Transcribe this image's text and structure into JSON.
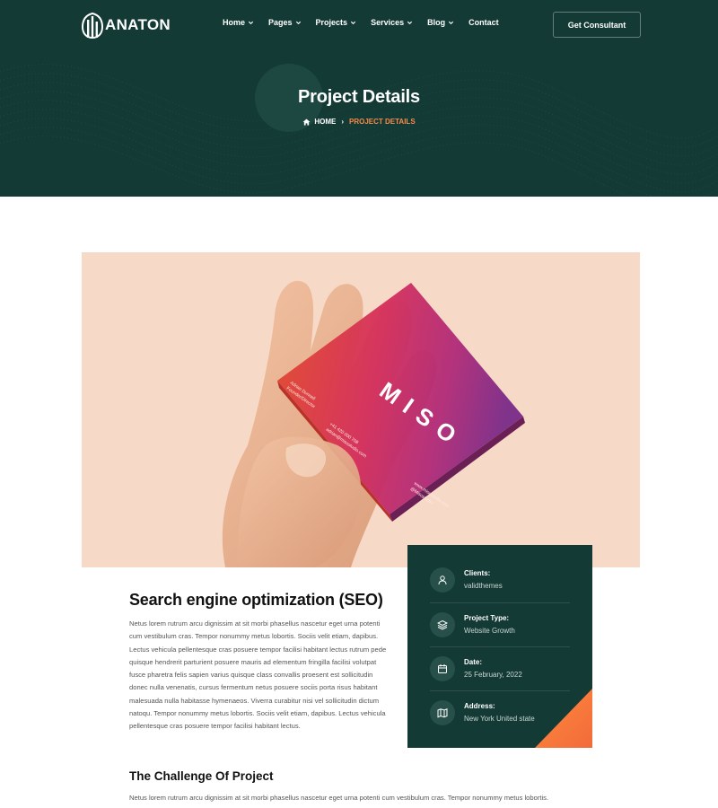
{
  "brand": {
    "name": "ANATON"
  },
  "nav": {
    "items": [
      {
        "label": "Home",
        "dropdown": true
      },
      {
        "label": "Pages",
        "dropdown": true
      },
      {
        "label": "Projects",
        "dropdown": true
      },
      {
        "label": "Services",
        "dropdown": true
      },
      {
        "label": "Blog",
        "dropdown": true
      },
      {
        "label": "Contact",
        "dropdown": false
      }
    ],
    "cta_label": "Get Consultant"
  },
  "hero": {
    "title": "Project Details",
    "breadcrumb": {
      "home": "HOME",
      "separator": "›",
      "current": "PROJECT DETAILS"
    }
  },
  "project_image": {
    "card_brand": "MISO",
    "card_name": "Adrian Dunnell",
    "card_role": "Founder/Director",
    "card_phone": "+41 420 000 708",
    "card_email": "adrian@misostudio.com",
    "card_web": "www.misostudio.com",
    "card_handle": "@Misostudio"
  },
  "info_card": {
    "items": [
      {
        "label": "Clients:",
        "value": "validthemes",
        "icon": "user-icon"
      },
      {
        "label": "Project Type:",
        "value": "Website Growth",
        "icon": "layers-icon"
      },
      {
        "label": "Date:",
        "value": "25 February, 2022",
        "icon": "calendar-icon"
      },
      {
        "label": "Address:",
        "value": "New York United state",
        "icon": "map-icon"
      }
    ]
  },
  "content": {
    "section_title": "Search engine optimization (SEO)",
    "section_body": "Netus lorem rutrum arcu dignissim at sit morbi phasellus nascetur eget urna potenti cum vestibulum cras. Tempor nonummy metus lobortis. Sociis velit etiam, dapibus. Lectus vehicula pellentesque cras posuere tempor facilisi habitant lectus rutrum pede quisque hendrerit parturient posuere mauris ad elementum fringilla facilisi volutpat fusce pharetra felis sapien varius quisque class convallis proesent est sollicitudin donec nulla venenatis, cursus fermentum netus posuere sociis porta risus habitant malesuada nulla habitasse hymenaeos. Viverra curabitur nisi vel sollicitudin dictum natoqu. Tempor nonummy metus lobortis. Sociis velit etiam, dapibus. Lectus vehicula pellentesque cras posuere tempor facilisi habitant lectus.",
    "challenge_title": "The Challenge Of Project",
    "challenge_body": "Netus lorem rutrum arcu dignissim at sit morbi phasellus nascetur eget urna potenti cum vestibulum cras. Tempor nonummy metus lobortis."
  },
  "colors": {
    "primary_dark": "#133a35",
    "accent_orange": "#f28c4a",
    "card_bg": "#f7d9c7"
  }
}
